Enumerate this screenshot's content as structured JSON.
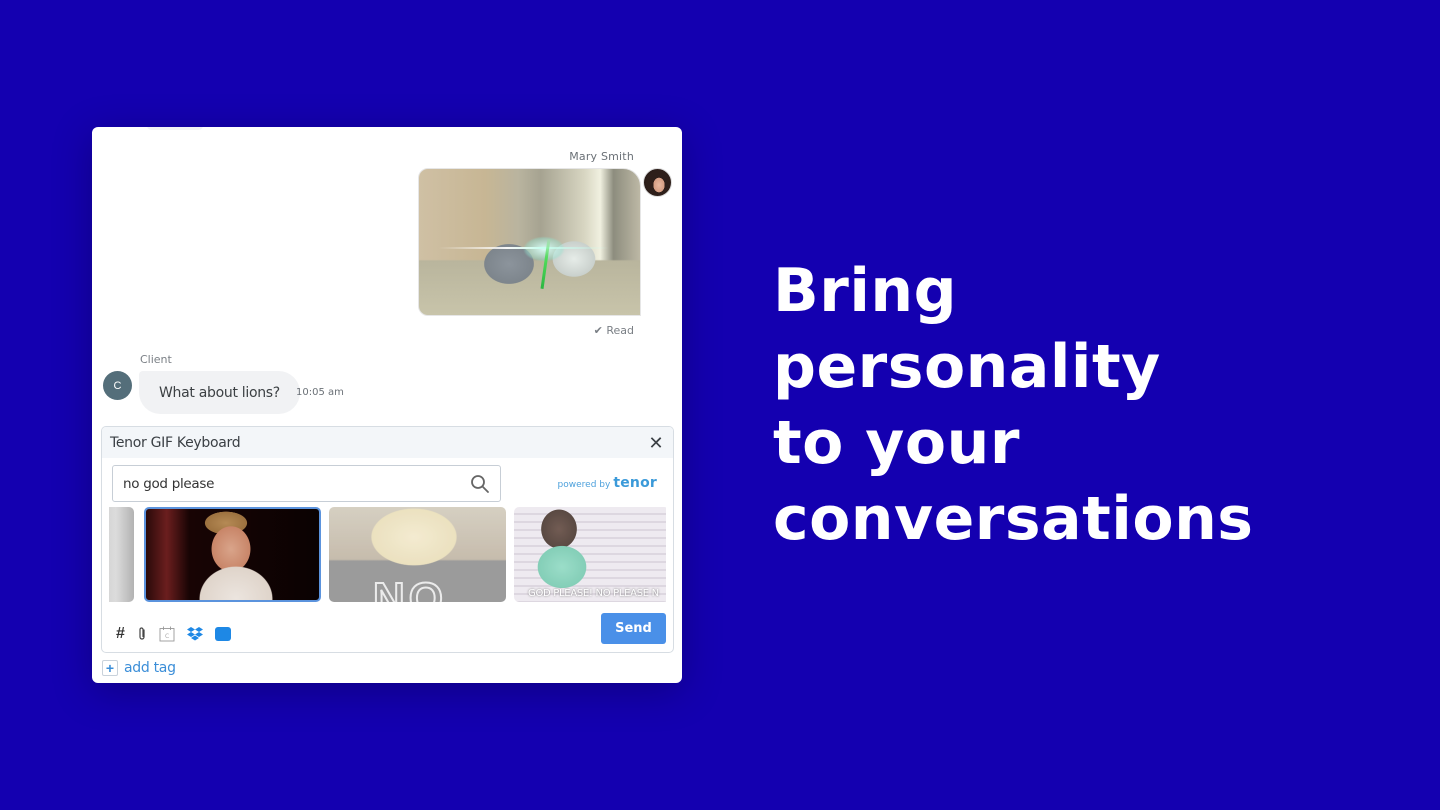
{
  "colors": {
    "background": "#1400b0",
    "accent": "#4a90e8",
    "link": "#3b8ed8",
    "client_avatar": "#546e7a"
  },
  "conversation": {
    "agent_message": {
      "sender": "Mary Smith",
      "avatar_icon": "profile-photo",
      "attachment": "gif-image",
      "status": "✔ Read"
    },
    "client_message": {
      "sender": "Client",
      "avatar_initial": "C",
      "text": "What about lions?",
      "time": "10:05 am"
    }
  },
  "gif_keyboard": {
    "title": "Tenor GIF Keyboard",
    "close_icon": "close-icon",
    "search": {
      "value": "no god please",
      "placeholder": "",
      "icon": "search-icon"
    },
    "powered_by": "powered by",
    "brand": "tenor",
    "results": [
      {
        "id": "partial-left",
        "caption": ""
      },
      {
        "id": "facepalm",
        "caption": "",
        "selected": true
      },
      {
        "id": "no-chick",
        "caption": "NO"
      },
      {
        "id": "god-please",
        "caption": "GOD PLEASE! NO PLEASE N"
      }
    ],
    "toolbar": [
      {
        "name": "hashtag",
        "glyph": "#"
      },
      {
        "name": "attachment",
        "glyph": "paperclip"
      },
      {
        "name": "calendar",
        "glyph": "calendar"
      },
      {
        "name": "dropbox",
        "glyph": "dropbox"
      },
      {
        "name": "tenor",
        "glyph": "tenor"
      }
    ],
    "send_label": "Send"
  },
  "add_tag_label": "add tag",
  "headline": {
    "lines": [
      "Bring",
      "personality",
      "to your",
      "conversations"
    ]
  }
}
